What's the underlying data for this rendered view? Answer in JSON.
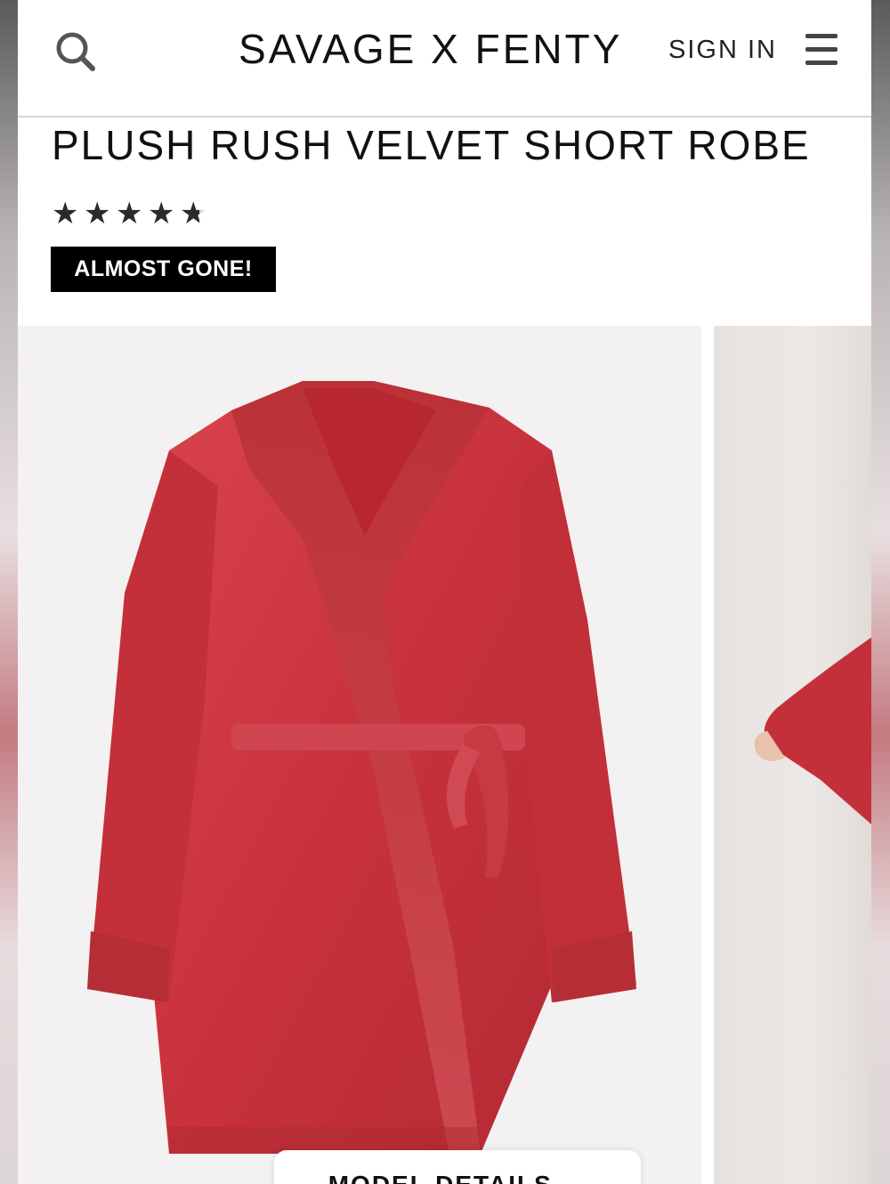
{
  "header": {
    "brand": "SAVAGE X FENTY",
    "sign_in": "SIGN IN"
  },
  "product": {
    "title": "PLUSH RUSH VELVET SHORT ROBE",
    "rating": 4.7,
    "stars": [
      "★",
      "★",
      "★",
      "★",
      "★"
    ],
    "badge": "ALMOST GONE!",
    "color": "#c8323b"
  },
  "gallery": {
    "model_details_label": "MODEL DETAILS",
    "model_details_icon": "chevron-down-icon"
  },
  "colors": {
    "robe": "#c8323b",
    "badge_bg": "#000000",
    "text": "#111111"
  }
}
